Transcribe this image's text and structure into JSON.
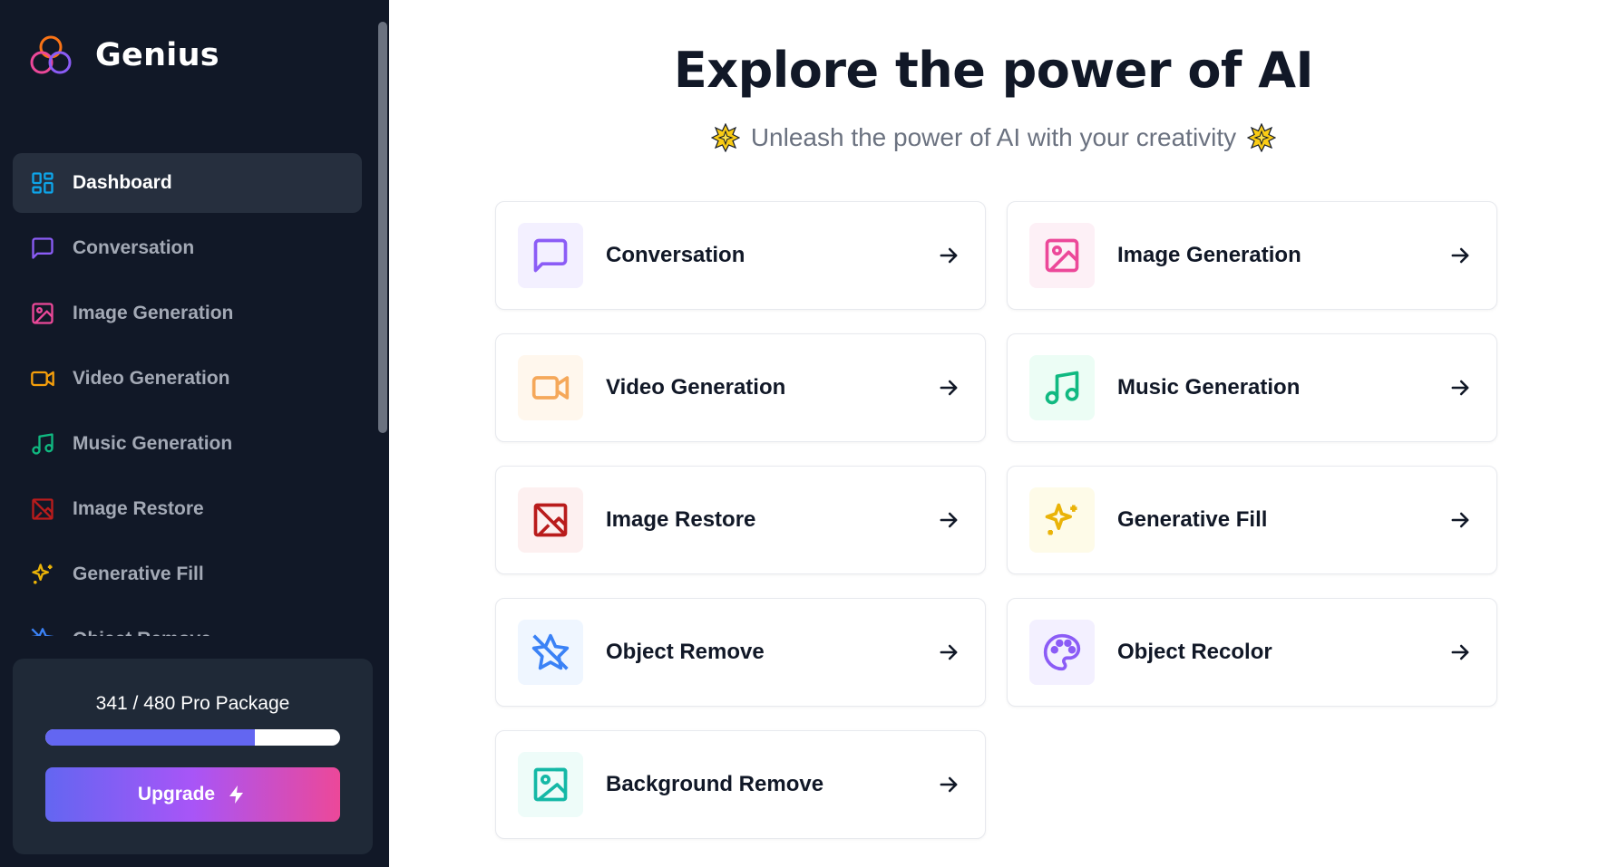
{
  "app": {
    "name": "Genius"
  },
  "sidebar": {
    "items": [
      {
        "label": "Dashboard",
        "icon": "dashboard-icon",
        "color": "#0ea5e9",
        "active": true
      },
      {
        "label": "Conversation",
        "icon": "message-square-icon",
        "color": "#8b5cf6"
      },
      {
        "label": "Image Generation",
        "icon": "image-icon",
        "color": "#ec4899"
      },
      {
        "label": "Video Generation",
        "icon": "video-icon",
        "color": "#f59e0b"
      },
      {
        "label": "Music Generation",
        "icon": "music-icon",
        "color": "#10b981"
      },
      {
        "label": "Image Restore",
        "icon": "image-off-icon",
        "color": "#b91c1c"
      },
      {
        "label": "Generative Fill",
        "icon": "sparkles-icon",
        "color": "#eab308"
      },
      {
        "label": "Object Remove",
        "icon": "star-off-icon",
        "color": "#3b82f6"
      }
    ]
  },
  "usage": {
    "text": "341 / 480 Pro Package",
    "used": 341,
    "limit": 480,
    "upgrade_label": "Upgrade"
  },
  "main": {
    "title": "Explore the power of AI",
    "subtitle": "Unleash the power of AI with your creativity",
    "cards": [
      {
        "label": "Conversation",
        "icon": "message-square-icon",
        "color": "#8b5cf6",
        "bg": "#f3f0ff"
      },
      {
        "label": "Image Generation",
        "icon": "image-icon",
        "color": "#ec4899",
        "bg": "#fdf0f6"
      },
      {
        "label": "Video Generation",
        "icon": "video-icon",
        "color": "#f5a85a",
        "bg": "#fff7ed"
      },
      {
        "label": "Music Generation",
        "icon": "music-icon",
        "color": "#10b981",
        "bg": "#ecfdf5"
      },
      {
        "label": "Image Restore",
        "icon": "image-off-icon",
        "color": "#b91c1c",
        "bg": "#fdf0f0"
      },
      {
        "label": "Generative Fill",
        "icon": "sparkles-icon",
        "color": "#eab308",
        "bg": "#fefbe8"
      },
      {
        "label": "Object Remove",
        "icon": "star-off-icon",
        "color": "#3b82f6",
        "bg": "#eff6ff"
      },
      {
        "label": "Object Recolor",
        "icon": "palette-icon",
        "color": "#8b5cf6",
        "bg": "#f3f0ff"
      },
      {
        "label": "Background Remove",
        "icon": "image-frame-icon",
        "color": "#14b8a6",
        "bg": "#eefcf9"
      }
    ]
  }
}
